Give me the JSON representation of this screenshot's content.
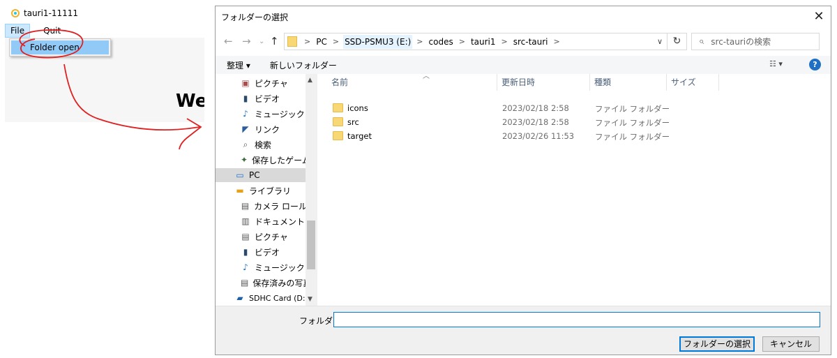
{
  "app": {
    "title": "tauri1-11111",
    "menu": {
      "file": "File",
      "quit": "Quit"
    },
    "dropdown_item": "Folder open",
    "welcome": "We"
  },
  "dialog": {
    "title": "フォルダーの選択",
    "breadcrumbs": [
      "PC",
      "SSD-PSMU3 (E:)",
      "codes",
      "tauri1",
      "src-tauri"
    ],
    "search_placeholder": "src-tauriの検索",
    "toolbar": {
      "organize": "整理 ▾",
      "new_folder": "新しいフォルダー"
    },
    "nav_items": [
      {
        "label": "ピクチャ",
        "icon": "pictures-icon"
      },
      {
        "label": "ビデオ",
        "icon": "videos-icon"
      },
      {
        "label": "ミュージック",
        "icon": "music-icon"
      },
      {
        "label": "リンク",
        "icon": "links-icon"
      },
      {
        "label": "検索",
        "icon": "search-icon"
      },
      {
        "label": "保存したゲーム",
        "icon": "saved-games-icon"
      },
      {
        "label": "PC",
        "icon": "pc-icon",
        "selected": true
      },
      {
        "label": "ライブラリ",
        "icon": "library-icon"
      },
      {
        "label": "カメラ ロール",
        "icon": "camera-roll-icon"
      },
      {
        "label": "ドキュメント",
        "icon": "documents-icon"
      },
      {
        "label": "ピクチャ",
        "icon": "pictures-icon"
      },
      {
        "label": "ビデオ",
        "icon": "videos-icon"
      },
      {
        "label": "ミュージック",
        "icon": "music-icon"
      },
      {
        "label": "保存済みの写真",
        "icon": "saved-pictures-icon"
      },
      {
        "label": "SDHC Card (D:)",
        "icon": "sd-card-icon"
      }
    ],
    "columns": {
      "name": "名前",
      "modified": "更新日時",
      "type": "種類",
      "size": "サイズ"
    },
    "files": [
      {
        "name": "icons",
        "modified": "2023/02/18 2:58",
        "type": "ファイル フォルダー"
      },
      {
        "name": "src",
        "modified": "2023/02/18 2:58",
        "type": "ファイル フォルダー"
      },
      {
        "name": "target",
        "modified": "2023/02/26 11:53",
        "type": "ファイル フォルダー"
      }
    ],
    "folder_label": "フォルダー:",
    "folder_value": "",
    "select_button": "フォルダーの選択",
    "cancel_button": "キャンセル"
  },
  "colors": {
    "accent": "#0078d7",
    "annotation": "#e02020",
    "menu_highlight": "#91c9f7"
  }
}
